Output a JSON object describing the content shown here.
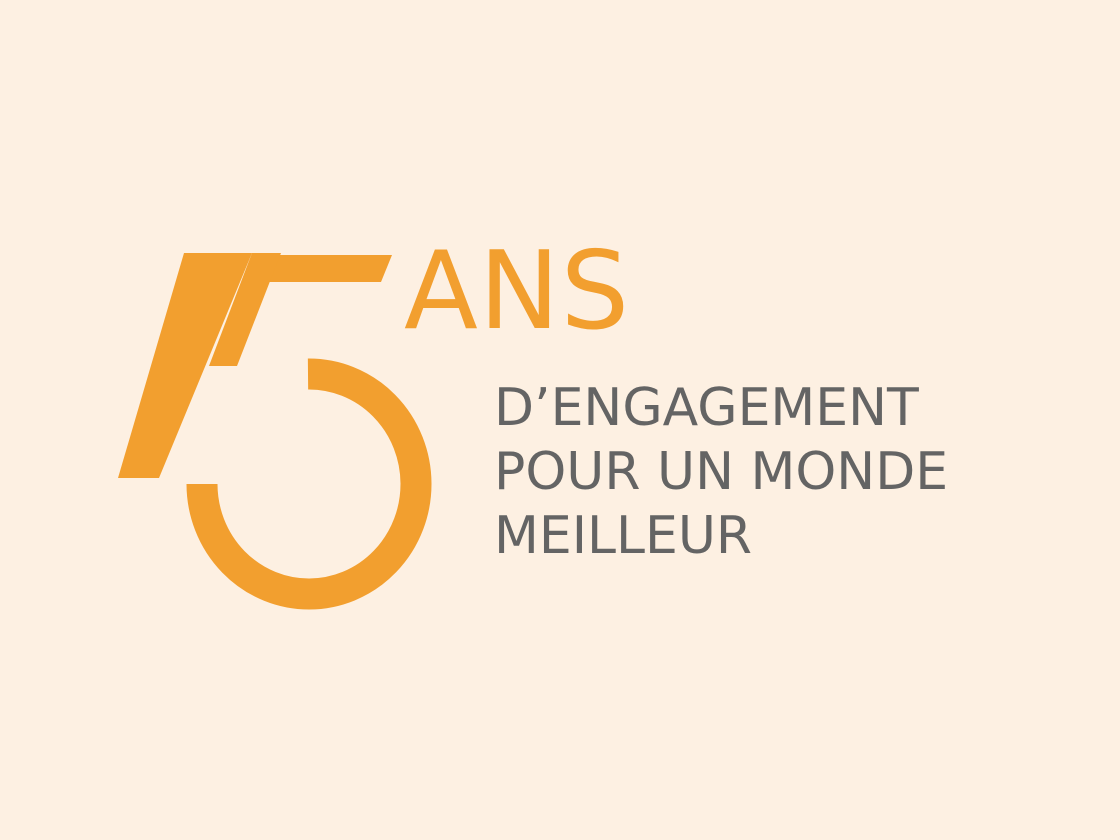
{
  "logo": {
    "number_text": "15",
    "ans_text": "ANS",
    "tagline_lines": [
      "D’ENGAGEMENT",
      "POUR UN MONDE",
      "MEILLEUR"
    ],
    "colors": {
      "background": "#fdf0e2",
      "accent": "#f29f2f",
      "text": "#646464"
    }
  }
}
